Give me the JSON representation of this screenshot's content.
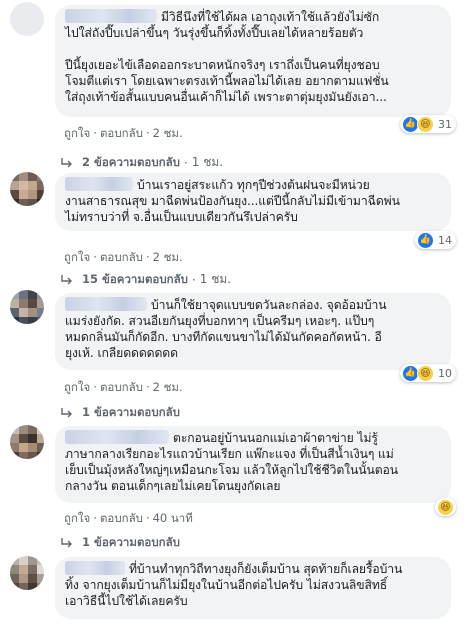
{
  "comments": [
    {
      "text": "มีวิธีนึงที่ใช้ได้ผล เอาถุงเท้าใช้แล้วยังไม่ซัก\nไปใส่ถังปี๊บเปล่าขึ้นๆ วันรุ่งขึ้นก็ทิ้งทั้งปี๊บเลยได้หลายร้อยตัว\n\nปีนี้ยุงเยอะไข้เลือดออกระบาดหนักจริงๆ เราถึ่งเป็นคนที่ยุงชอบ\nโจมตีแต่เรา โดยเฉพาะตรงเท้านี้พลอไม่ได้เลย อยากตามแฟชั่น\nใส่ถุงเท้าข้อสั้นแบบคนอื่นเค้าก็ไม่ได้ เพราะตาตุ่มยุงมันยังเอา...",
      "reaction_count": "31",
      "reactions": [
        "like",
        "haha"
      ],
      "actions": {
        "like": "ถูกใจ",
        "reply": "ตอบกลับ",
        "time": "2 ชม."
      },
      "replies": {
        "label": "2 ข้อความตอบกลับ",
        "time": "1 ชม."
      }
    },
    {
      "text": "บ้านเราอยู่สระแก้ว ทุกๆปีช่วงต้นฝนจะมีหน่วย\nงานสาธารณสุข มาฉีดพ่นป้องกันยุง...แต่ปีนี้กลับไม่มีเข้ามาฉีดพ่น\nไม่ทราบว่าที่ จ.อื่นเป็นแบบเดียวกันรึเปล่าครับ",
      "reaction_count": "14",
      "reactions": [
        "like"
      ],
      "actions": {
        "like": "ถูกใจ",
        "reply": "ตอบกลับ",
        "time": "2 ชม."
      },
      "replies": {
        "label": "15 ข้อความตอบกลับ",
        "time": "1 ชม."
      }
    },
    {
      "text": "บ้านก็ใช้ยาจุดแบบขดวันละกล่อง. จุดอ้อมบ้าน\nแมร่งยังกัด. สวนอีเยกันยุงที่บอกทาๆ เป็นครีมๆ เหอะๆ. แป๊บๆ\nหมดกลิ่นมันก็กัดอีก. บางทีกัดแขนขาไม่ได้มันกัดคอกัดหน้า. อี\nยุงเห้. เกลียดดดดดดด",
      "reaction_count": "10",
      "reactions": [
        "like",
        "haha"
      ],
      "actions": {
        "like": "ถูกใจ",
        "reply": "ตอบกลับ",
        "time": "2 ชม."
      },
      "replies": {
        "label": "1 ข้อความตอบกลับ",
        "time": ""
      }
    },
    {
      "text": "ตะกอนอยู่บ้านนอกแม่เอาผ้าตาข่าย ไม่รู้\nภาษากลางเรียกอะไรแถวบ้านเรียก แพ๊กะแจง ที่เป็นสีน้ำเงินๆ แม่\nเย็บเป็นมุ้งหลังใหญ่ๆเหมือนกะโจม แล้วให้ลูกไปใช้ชีวิตในนั้นตอน\nกลางวัน ตอนเด็กๆเลยไม่เคยโดนยุงกัดเลย",
      "reaction_count": "",
      "reactions": [
        "haha"
      ],
      "actions": {
        "like": "ถูกใจ",
        "reply": "ตอบกลับ",
        "time": "40 นาที"
      },
      "replies": {
        "label": "1 ข้อความตอบกลับ",
        "time": ""
      }
    },
    {
      "text": "ที่บ้านทำทุกวิถีทางยุงก็ยังเต็มบ้าน สุดท้ายก็เลยรื้อบ้าน\nทิ้ง จากยุงเต็มบ้านก็ไม่มียุงในบ้านอีกต่อไปครับ ไม่สงวนลิขสิทธิ์\nเอาวิธีนี้ไปใช้ได้เลยครับ",
      "reaction_count": "",
      "reactions": [],
      "actions": {
        "like": "",
        "reply": "",
        "time": ""
      },
      "replies": {
        "label": "",
        "time": ""
      }
    }
  ]
}
